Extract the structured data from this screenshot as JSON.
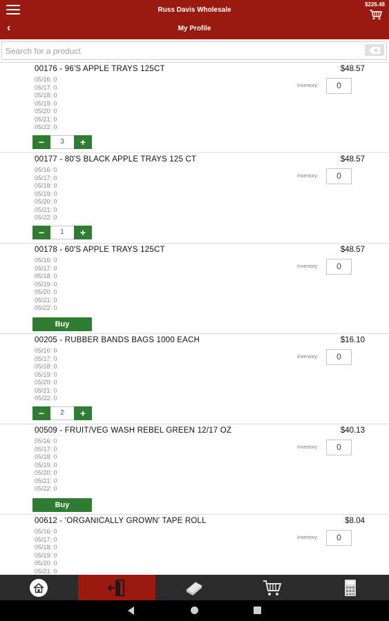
{
  "header": {
    "app_title": "Russ Davis Wholesale",
    "page_title": "My Profile",
    "cart_total": "$226.48"
  },
  "search": {
    "placeholder": "Search for a product",
    "value": ""
  },
  "inventory_label": "Inventory:",
  "buy_label": "Buy",
  "products": [
    {
      "title": "00176 - 96'S APPLE TRAYS 125CT",
      "price": "$48.57",
      "history": [
        "05/16: 0",
        "05/17: 0",
        "05/18: 0",
        "05/19: 0",
        "05/20: 0",
        "05/21: 0",
        "05/22: 0"
      ],
      "inventory": "0",
      "quantity": "3",
      "minus": "−",
      "plus": "+"
    },
    {
      "title": "00177 - 80'S BLACK APPLE TRAYS 125 CT",
      "price": "$48.57",
      "history": [
        "05/16: 0",
        "05/17: 0",
        "05/18: 0",
        "05/19: 0",
        "05/20: 0",
        "05/21: 0",
        "05/22: 0"
      ],
      "inventory": "0",
      "quantity": "1",
      "minus": "−",
      "plus": "+"
    },
    {
      "title": "00178 - 60'S APPLE TRAYS 125CT",
      "price": "$48.57",
      "history": [
        "05/16: 0",
        "05/17: 0",
        "05/18: 0",
        "05/19: 0",
        "05/20: 0",
        "05/21: 0",
        "05/22: 0"
      ],
      "inventory": "0"
    },
    {
      "title": "00205 - RUBBER BANDS BAGS 1000 EACH",
      "price": "$16.10",
      "history": [
        "05/16: 0",
        "05/17: 0",
        "05/18: 0",
        "05/19: 0",
        "05/20: 0",
        "05/21: 0",
        "05/22: 0"
      ],
      "inventory": "0",
      "quantity": "2",
      "minus": "−",
      "plus": "+"
    },
    {
      "title": "00509 - FRUIT/VEG WASH REBEL GREEN 12/17 OZ",
      "price": "$40.13",
      "history": [
        "05/16: 0",
        "05/17: 0",
        "05/18: 0",
        "05/19: 0",
        "05/20: 0",
        "05/21: 0",
        "05/22: 0"
      ],
      "inventory": "0"
    },
    {
      "title": "00612 - 'ORGANICALLY GROWN' TAPE ROLL",
      "price": "$8.04",
      "history": [
        "05/16: 0",
        "05/17: 0",
        "05/18: 0",
        "05/19: 0",
        "05/20: 0",
        "05/21: 0"
      ],
      "inventory": "0"
    }
  ],
  "bottom_nav": [
    {
      "icon": "home-icon",
      "active": false
    },
    {
      "icon": "logout-icon",
      "active": true
    },
    {
      "icon": "catalog-icon",
      "active": false
    },
    {
      "icon": "cart-icon",
      "active": false
    },
    {
      "icon": "calculator-icon",
      "active": false
    }
  ],
  "colors": {
    "brand_red": "#9b1a10",
    "action_green": "#2e7d32",
    "nav_dark": "#2b2b2b"
  }
}
